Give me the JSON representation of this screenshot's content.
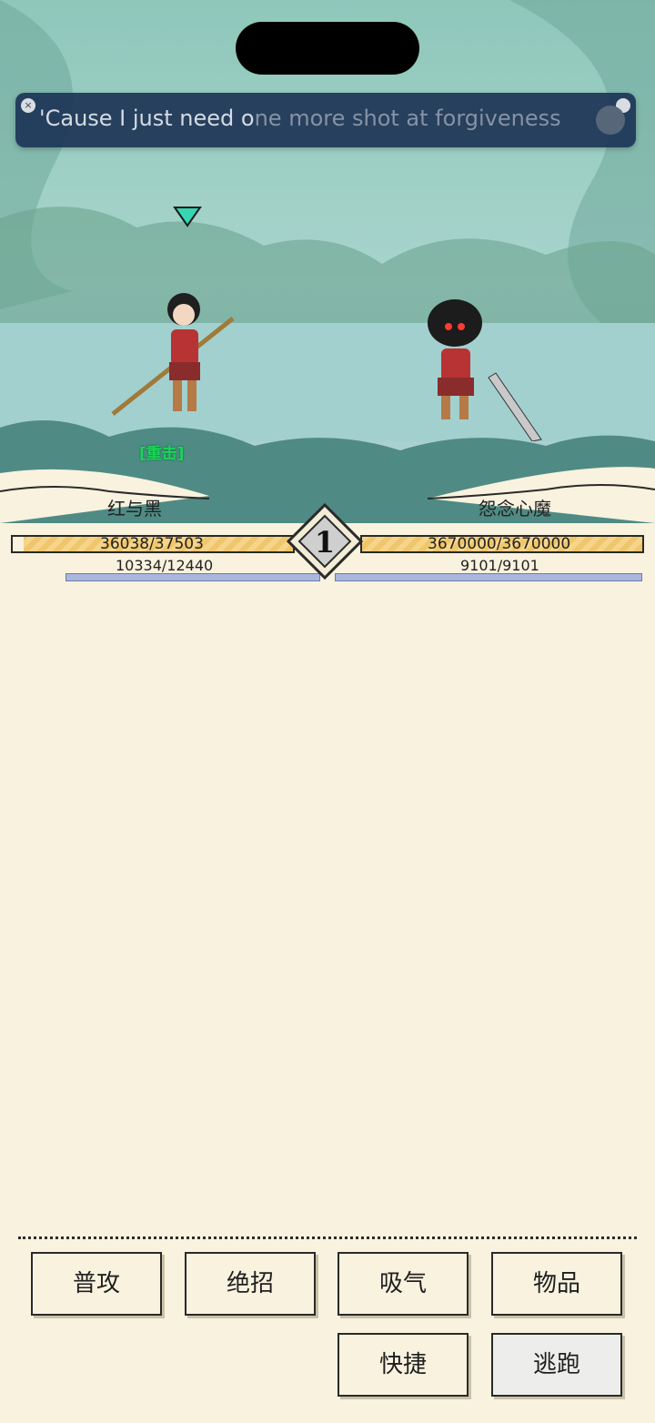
{
  "lyric": {
    "text_bright": "'Cause I just need o",
    "text_dim": "ne more shot at forgiveness"
  },
  "battle": {
    "left": {
      "name": "红与黑",
      "hp": "36038/37503",
      "mp": "10334/12440",
      "hp_ratio": 0.961,
      "mp_ratio": 0.831
    },
    "right": {
      "name": "怨念心魔",
      "hp": "3670000/3670000",
      "mp": "9101/9101",
      "hp_ratio": 1.0,
      "mp_ratio": 1.0
    },
    "turn": "1",
    "status_tag": "[重击]"
  },
  "actions": {
    "attack": "普攻",
    "ultimate": "绝招",
    "breathe": "吸气",
    "items": "物品",
    "shortcut": "快捷",
    "flee": "逃跑"
  },
  "colors": {
    "hp_fill": "#f6d58a",
    "mp_fill": "#a9b7dc",
    "panel_bg": "#f8f2df",
    "marker": "#37d6b3"
  }
}
